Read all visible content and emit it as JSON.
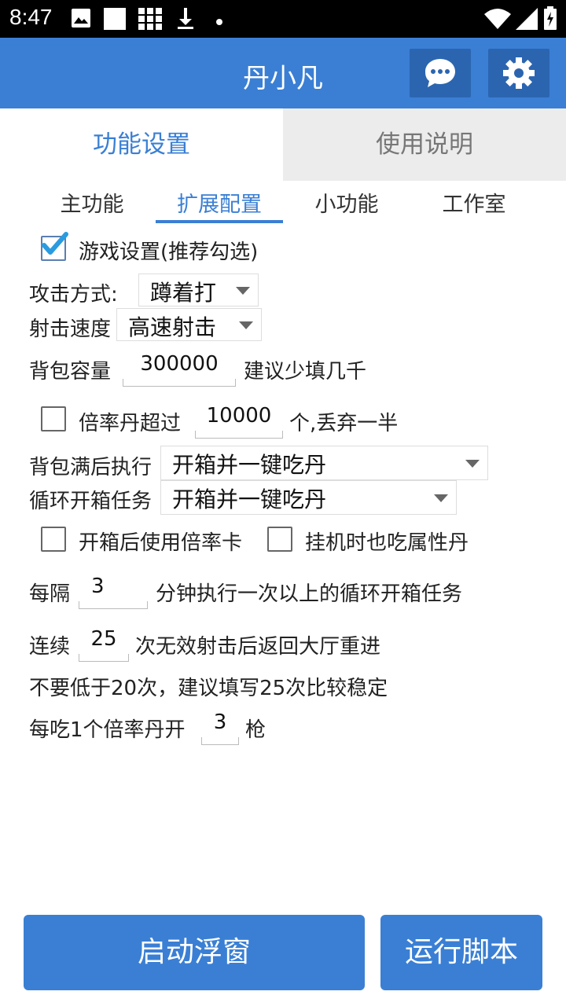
{
  "status": {
    "time": "8:47"
  },
  "app": {
    "title": "丹小凡"
  },
  "tabs": {
    "main": "功能设置",
    "help": "使用说明"
  },
  "subtabs": [
    "主功能",
    "扩展配置",
    "小功能",
    "工作室"
  ],
  "form": {
    "game_settings_label": "游戏设置(推荐勾选)",
    "attack_mode_label": "攻击方式:",
    "attack_mode_value": "蹲着打",
    "shoot_speed_label": "射击速度",
    "shoot_speed_value": "高速射击",
    "bag_capacity_label": "背包容量",
    "bag_capacity_value": "300000",
    "bag_capacity_hint": "建议少填几千",
    "rate_pill_label": "倍率丹超过",
    "rate_pill_value": "10000",
    "rate_pill_suffix": "个,丢弃一半",
    "bag_full_label": "背包满后执行",
    "bag_full_value": "开箱并一键吃丹",
    "loop_task_label": "循环开箱任务",
    "loop_task_value": "开箱并一键吃丹",
    "use_rate_card_label": "开箱后使用倍率卡",
    "eat_attr_pill_label": "挂机时也吃属性丹",
    "interval_prefix": "每隔",
    "interval_value": "3",
    "interval_suffix": "分钟执行一次以上的循环开箱任务",
    "consecutive_prefix": "连续",
    "consecutive_value": "25",
    "consecutive_suffix": "次无效射击后返回大厅重进",
    "consecutive_note": "不要低于20次，建议填写25次比较稳定",
    "per_pill_prefix": "每吃1个倍率丹开",
    "per_pill_value": "3",
    "per_pill_suffix": "枪"
  },
  "buttons": {
    "float": "启动浮窗",
    "run": "运行脚本"
  },
  "colors": {
    "primary": "#3a7fd4",
    "primary_dark": "#2b65b0"
  }
}
